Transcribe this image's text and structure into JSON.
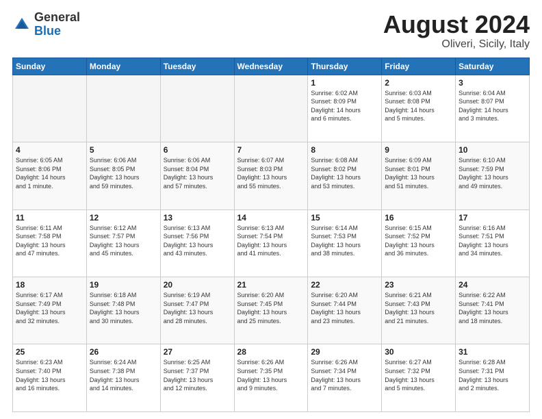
{
  "header": {
    "logo_general": "General",
    "logo_blue": "Blue",
    "month_title": "August 2024",
    "subtitle": "Oliveri, Sicily, Italy"
  },
  "days_of_week": [
    "Sunday",
    "Monday",
    "Tuesday",
    "Wednesday",
    "Thursday",
    "Friday",
    "Saturday"
  ],
  "weeks": [
    [
      {
        "num": "",
        "info": ""
      },
      {
        "num": "",
        "info": ""
      },
      {
        "num": "",
        "info": ""
      },
      {
        "num": "",
        "info": ""
      },
      {
        "num": "1",
        "info": "Sunrise: 6:02 AM\nSunset: 8:09 PM\nDaylight: 14 hours\nand 6 minutes."
      },
      {
        "num": "2",
        "info": "Sunrise: 6:03 AM\nSunset: 8:08 PM\nDaylight: 14 hours\nand 5 minutes."
      },
      {
        "num": "3",
        "info": "Sunrise: 6:04 AM\nSunset: 8:07 PM\nDaylight: 14 hours\nand 3 minutes."
      }
    ],
    [
      {
        "num": "4",
        "info": "Sunrise: 6:05 AM\nSunset: 8:06 PM\nDaylight: 14 hours\nand 1 minute."
      },
      {
        "num": "5",
        "info": "Sunrise: 6:06 AM\nSunset: 8:05 PM\nDaylight: 13 hours\nand 59 minutes."
      },
      {
        "num": "6",
        "info": "Sunrise: 6:06 AM\nSunset: 8:04 PM\nDaylight: 13 hours\nand 57 minutes."
      },
      {
        "num": "7",
        "info": "Sunrise: 6:07 AM\nSunset: 8:03 PM\nDaylight: 13 hours\nand 55 minutes."
      },
      {
        "num": "8",
        "info": "Sunrise: 6:08 AM\nSunset: 8:02 PM\nDaylight: 13 hours\nand 53 minutes."
      },
      {
        "num": "9",
        "info": "Sunrise: 6:09 AM\nSunset: 8:01 PM\nDaylight: 13 hours\nand 51 minutes."
      },
      {
        "num": "10",
        "info": "Sunrise: 6:10 AM\nSunset: 7:59 PM\nDaylight: 13 hours\nand 49 minutes."
      }
    ],
    [
      {
        "num": "11",
        "info": "Sunrise: 6:11 AM\nSunset: 7:58 PM\nDaylight: 13 hours\nand 47 minutes."
      },
      {
        "num": "12",
        "info": "Sunrise: 6:12 AM\nSunset: 7:57 PM\nDaylight: 13 hours\nand 45 minutes."
      },
      {
        "num": "13",
        "info": "Sunrise: 6:13 AM\nSunset: 7:56 PM\nDaylight: 13 hours\nand 43 minutes."
      },
      {
        "num": "14",
        "info": "Sunrise: 6:13 AM\nSunset: 7:54 PM\nDaylight: 13 hours\nand 41 minutes."
      },
      {
        "num": "15",
        "info": "Sunrise: 6:14 AM\nSunset: 7:53 PM\nDaylight: 13 hours\nand 38 minutes."
      },
      {
        "num": "16",
        "info": "Sunrise: 6:15 AM\nSunset: 7:52 PM\nDaylight: 13 hours\nand 36 minutes."
      },
      {
        "num": "17",
        "info": "Sunrise: 6:16 AM\nSunset: 7:51 PM\nDaylight: 13 hours\nand 34 minutes."
      }
    ],
    [
      {
        "num": "18",
        "info": "Sunrise: 6:17 AM\nSunset: 7:49 PM\nDaylight: 13 hours\nand 32 minutes."
      },
      {
        "num": "19",
        "info": "Sunrise: 6:18 AM\nSunset: 7:48 PM\nDaylight: 13 hours\nand 30 minutes."
      },
      {
        "num": "20",
        "info": "Sunrise: 6:19 AM\nSunset: 7:47 PM\nDaylight: 13 hours\nand 28 minutes."
      },
      {
        "num": "21",
        "info": "Sunrise: 6:20 AM\nSunset: 7:45 PM\nDaylight: 13 hours\nand 25 minutes."
      },
      {
        "num": "22",
        "info": "Sunrise: 6:20 AM\nSunset: 7:44 PM\nDaylight: 13 hours\nand 23 minutes."
      },
      {
        "num": "23",
        "info": "Sunrise: 6:21 AM\nSunset: 7:43 PM\nDaylight: 13 hours\nand 21 minutes."
      },
      {
        "num": "24",
        "info": "Sunrise: 6:22 AM\nSunset: 7:41 PM\nDaylight: 13 hours\nand 18 minutes."
      }
    ],
    [
      {
        "num": "25",
        "info": "Sunrise: 6:23 AM\nSunset: 7:40 PM\nDaylight: 13 hours\nand 16 minutes."
      },
      {
        "num": "26",
        "info": "Sunrise: 6:24 AM\nSunset: 7:38 PM\nDaylight: 13 hours\nand 14 minutes."
      },
      {
        "num": "27",
        "info": "Sunrise: 6:25 AM\nSunset: 7:37 PM\nDaylight: 13 hours\nand 12 minutes."
      },
      {
        "num": "28",
        "info": "Sunrise: 6:26 AM\nSunset: 7:35 PM\nDaylight: 13 hours\nand 9 minutes."
      },
      {
        "num": "29",
        "info": "Sunrise: 6:26 AM\nSunset: 7:34 PM\nDaylight: 13 hours\nand 7 minutes."
      },
      {
        "num": "30",
        "info": "Sunrise: 6:27 AM\nSunset: 7:32 PM\nDaylight: 13 hours\nand 5 minutes."
      },
      {
        "num": "31",
        "info": "Sunrise: 6:28 AM\nSunset: 7:31 PM\nDaylight: 13 hours\nand 2 minutes."
      }
    ]
  ]
}
